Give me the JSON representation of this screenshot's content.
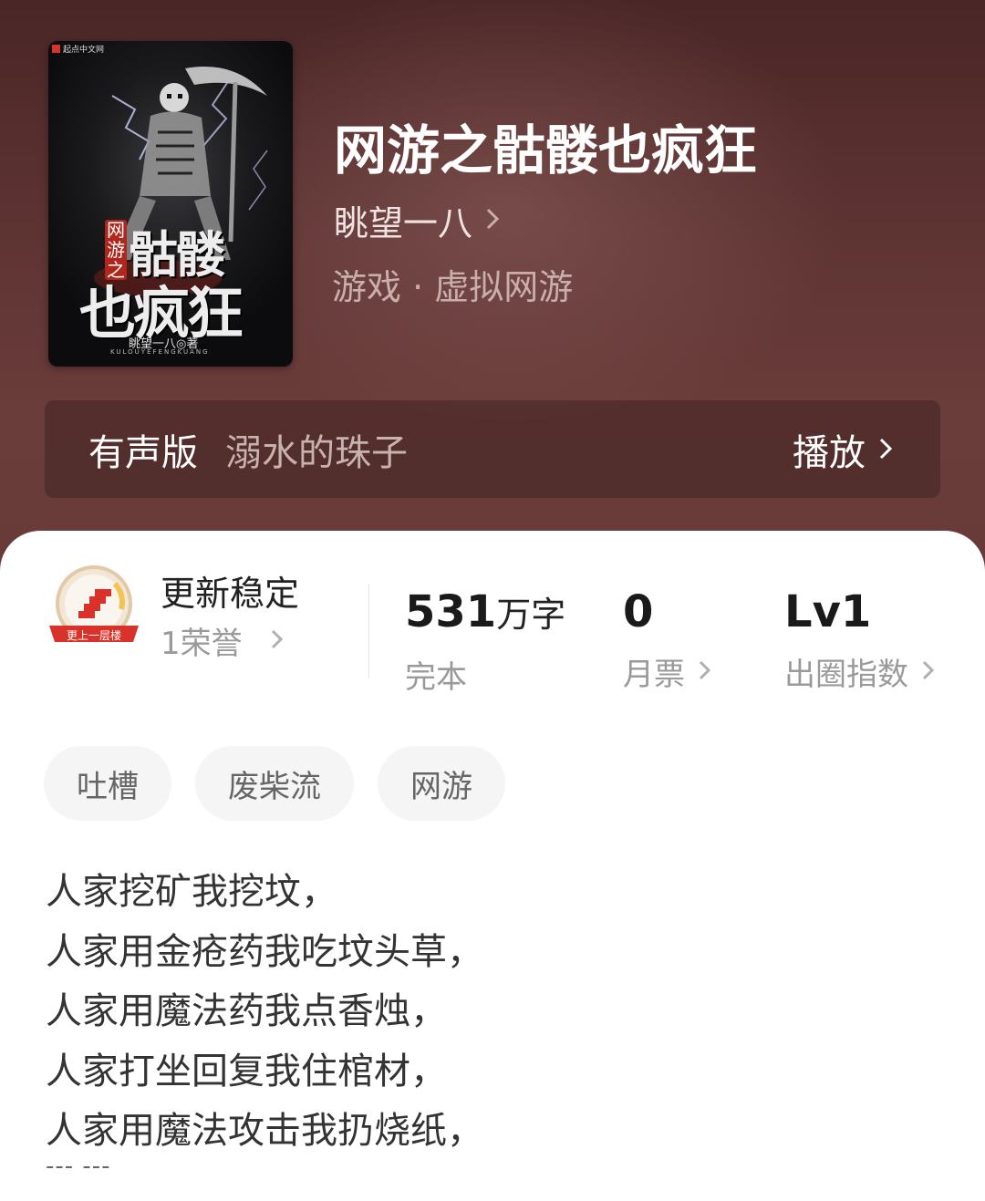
{
  "book": {
    "title": "网游之骷髅也疯狂",
    "author": "眺望一八",
    "genre": "游戏 · 虚拟网游"
  },
  "cover": {
    "publisher_mark": "起点中文网",
    "title_small": "网游之",
    "title_large_1": "骷髅",
    "title_large_2": "也疯狂",
    "credit": "眺望一八◎著",
    "romanized": "KULOUYEFENGKUANG",
    "icon": "skeleton-reaper-cover-art"
  },
  "audio": {
    "label": "有声版",
    "narrator": "溺水的珠子",
    "play_label": "播放"
  },
  "honor": {
    "badge_icon": "stairs-badge-icon",
    "badge_text": "更上一层楼",
    "title": "更新稳定",
    "count": "1荣誉"
  },
  "stats": {
    "words_value": "531",
    "words_unit": "万字",
    "status": "完本",
    "monthly_votes_value": "0",
    "monthly_votes_label": "月票",
    "level_value": "Lv1",
    "level_label": "出圈指数"
  },
  "tags": [
    "吐槽",
    "废柴流",
    "网游"
  ],
  "description": [
    "人家挖矿我挖坟，",
    "人家用金疮药我吃坟头草，",
    "人家用魔法药我点香烛，",
    "人家打坐回复我住棺材，",
    "人家用魔法攻击我扔烧纸，"
  ],
  "description_more": "--- ---",
  "colors": {
    "hero_bg": "#5e3433",
    "badge_red": "#d8322a"
  }
}
